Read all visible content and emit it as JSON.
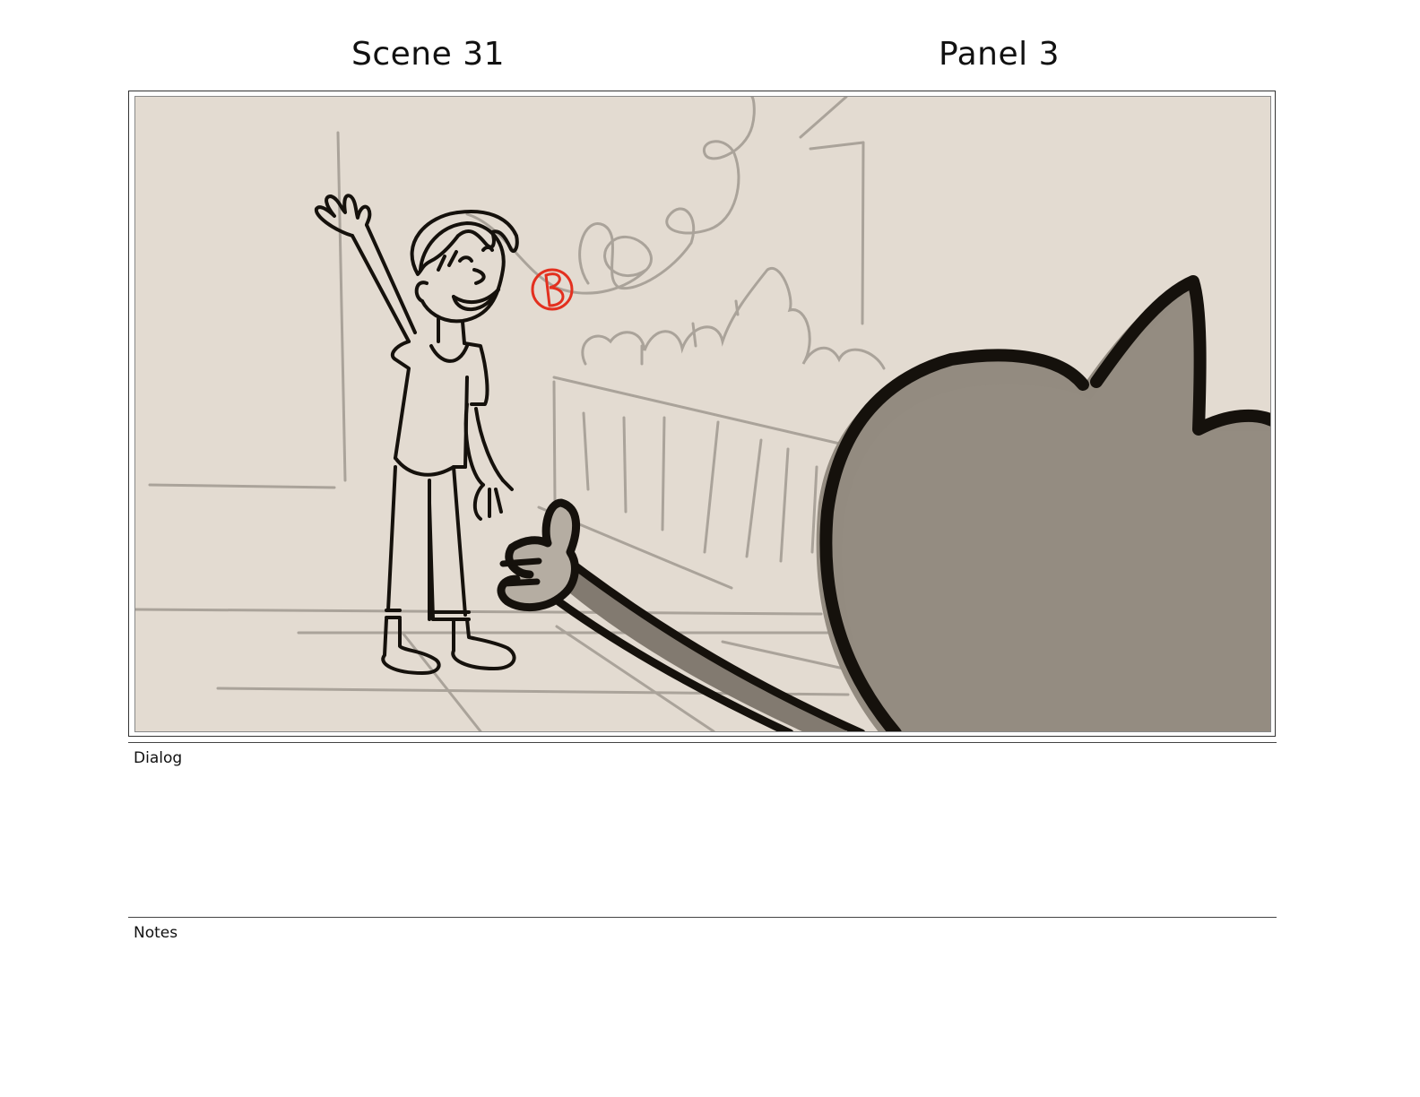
{
  "header": {
    "scene_label": "Scene 31",
    "panel_label": "Panel 3"
  },
  "panel_image": {
    "annotation_mark": "B",
    "colors": {
      "background": "#e3dbd1",
      "ink": "#15110c",
      "background_lines": "#aaa39a",
      "silhouette_fill": "#938b80",
      "annotation_red": "#e3301f"
    }
  },
  "sections": {
    "dialog_label": "Dialog",
    "dialog_text": "",
    "notes_label": "Notes",
    "notes_text": ""
  }
}
